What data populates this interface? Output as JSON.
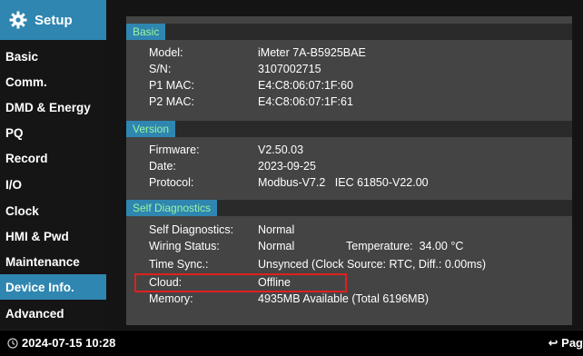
{
  "sidebar": {
    "title": "Setup",
    "items": [
      {
        "label": "Basic"
      },
      {
        "label": "Comm."
      },
      {
        "label": "DMD & Energy"
      },
      {
        "label": "PQ"
      },
      {
        "label": "Record"
      },
      {
        "label": "I/O"
      },
      {
        "label": "Clock"
      },
      {
        "label": "HMI & Pwd"
      },
      {
        "label": "Maintenance"
      },
      {
        "label": "Device Info."
      },
      {
        "label": "Advanced"
      }
    ],
    "active_item": "Device Info."
  },
  "basic": {
    "header": "Basic",
    "model_label": "Model:",
    "model_value": "iMeter 7A-B5925BAE",
    "sn_label": "S/N:",
    "sn_value": "3107002715",
    "p1mac_label": "P1 MAC:",
    "p1mac_value": "E4:C8:06:07:1F:60",
    "p2mac_label": "P2 MAC:",
    "p2mac_value": "E4:C8:06:07:1F:61"
  },
  "version": {
    "header": "Version",
    "firmware_label": "Firmware:",
    "firmware_value": "V2.50.03",
    "date_label": "Date:",
    "date_value": "2023-09-25",
    "protocol_label": "Protocol:",
    "protocol_value": "Modbus-V7.2   IEC 61850-V22.00"
  },
  "self_diagnostics": {
    "header": "Self Diagnostics",
    "self_diag_label": "Self Diagnostics:",
    "self_diag_value": "Normal",
    "wiring_label": "Wiring Status:",
    "wiring_value": "Normal",
    "temperature_text": "Temperature:  34.00 °C",
    "timesync_label": "Time Sync.:",
    "timesync_value": "Unsynced (Clock Source: RTC, Diff.: 0.00ms)",
    "cloud_label": "Cloud:",
    "cloud_value": "Offline",
    "memory_label": "Memory:",
    "memory_value": "4935MB Available (Total 6196MB)"
  },
  "statusbar": {
    "datetime": "2024-07-15 10:28",
    "page_nav": "↩ Pag"
  },
  "colors": {
    "accent": "#2f86b0",
    "section_text": "#9df59f",
    "highlight": "#e02020"
  }
}
